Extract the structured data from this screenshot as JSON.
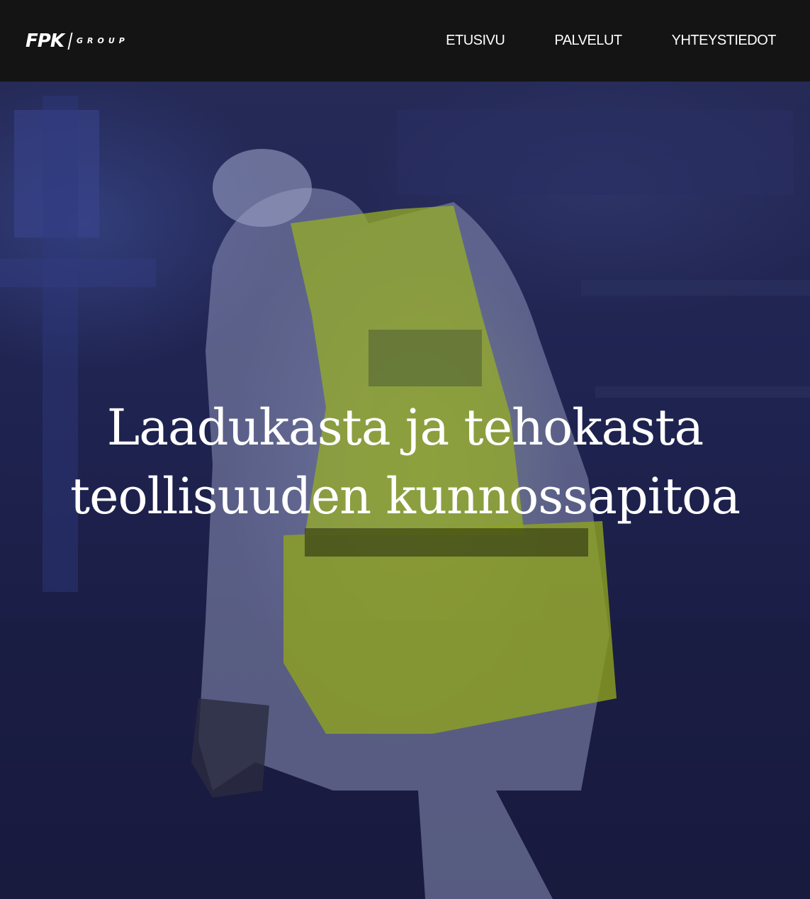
{
  "brand": {
    "mark": "FPK",
    "word": "GROUP"
  },
  "nav": {
    "items": [
      {
        "label": "ETUSIVU"
      },
      {
        "label": "PALVELUT"
      },
      {
        "label": "YHTEYSTIEDOT"
      }
    ]
  },
  "hero": {
    "title_line1": "Laadukasta ja tehokasta",
    "title_line2": "teollisuuden kunnossapitoa",
    "background_image": "worker-in-protective-suit-and-hi-vis-vest-photo"
  },
  "colors": {
    "navbar_bg": "#141414",
    "hero_overlay": "#1f2350",
    "vest_accent": "#b9d12a",
    "text": "#ffffff"
  }
}
